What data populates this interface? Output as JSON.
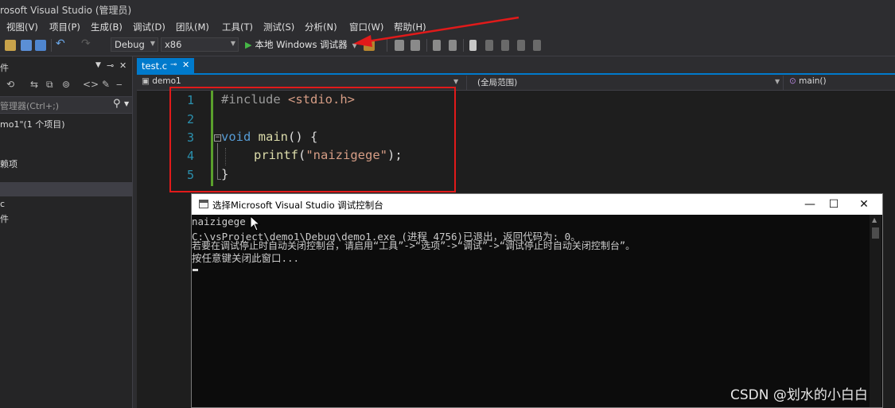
{
  "window": {
    "title": "rosoft Visual Studio (管理员)"
  },
  "menu": {
    "items": [
      "视图(V)",
      "项目(P)",
      "生成(B)",
      "调试(D)",
      "团队(M)",
      "工具(T)",
      "测试(S)",
      "分析(N)",
      "窗口(W)",
      "帮助(H)"
    ]
  },
  "toolbar": {
    "config": "Debug",
    "platform": "x86",
    "run_label": "本地 Windows 调试器"
  },
  "solution_explorer": {
    "search_placeholder": "管理器(Ctrl+;)",
    "solution_label": "mo1\"(1 个项目)",
    "item_cut": "赖项",
    "item_c": "c",
    "item_file": "件"
  },
  "editor": {
    "tab_label": "test.c",
    "tab_pin": "⊸",
    "tab_close": "✕",
    "nav_project": "demo1",
    "nav_scope": "(全局范围)",
    "nav_member": "main()",
    "line_numbers": [
      "1",
      "2",
      "3",
      "4",
      "5"
    ],
    "code": {
      "line1_directive": "#include",
      "line1_header": "<stdio.h>",
      "line3_type": "void",
      "line3_fn": "main",
      "line3_rest": "() {",
      "line4_fn": "printf",
      "line4_open": "(",
      "line4_str": "\"naizigege\"",
      "line4_close": ");",
      "line5": "}"
    }
  },
  "console": {
    "title": "选择Microsoft Visual Studio 调试控制台",
    "minimize": "—",
    "maximize": "☐",
    "close": "✕",
    "lines": [
      "naizigege",
      "C:\\vsProject\\demo1\\Debug\\demo1.exe (进程 4756)已退出，返回代码为: 0。",
      "若要在调试停止时自动关闭控制台，请启用“工具”->“选项”->“调试”->“调试停止时自动关闭控制台”。",
      "按任意键关闭此窗口..."
    ]
  },
  "watermark": "CSDN @划水的小白白",
  "colors": {
    "accent": "#007acc",
    "annotation_red": "#e11a1a",
    "keyword": "#569cd6",
    "function": "#dcdcaa",
    "string": "#d69d85",
    "line_number": "#2b91af"
  }
}
